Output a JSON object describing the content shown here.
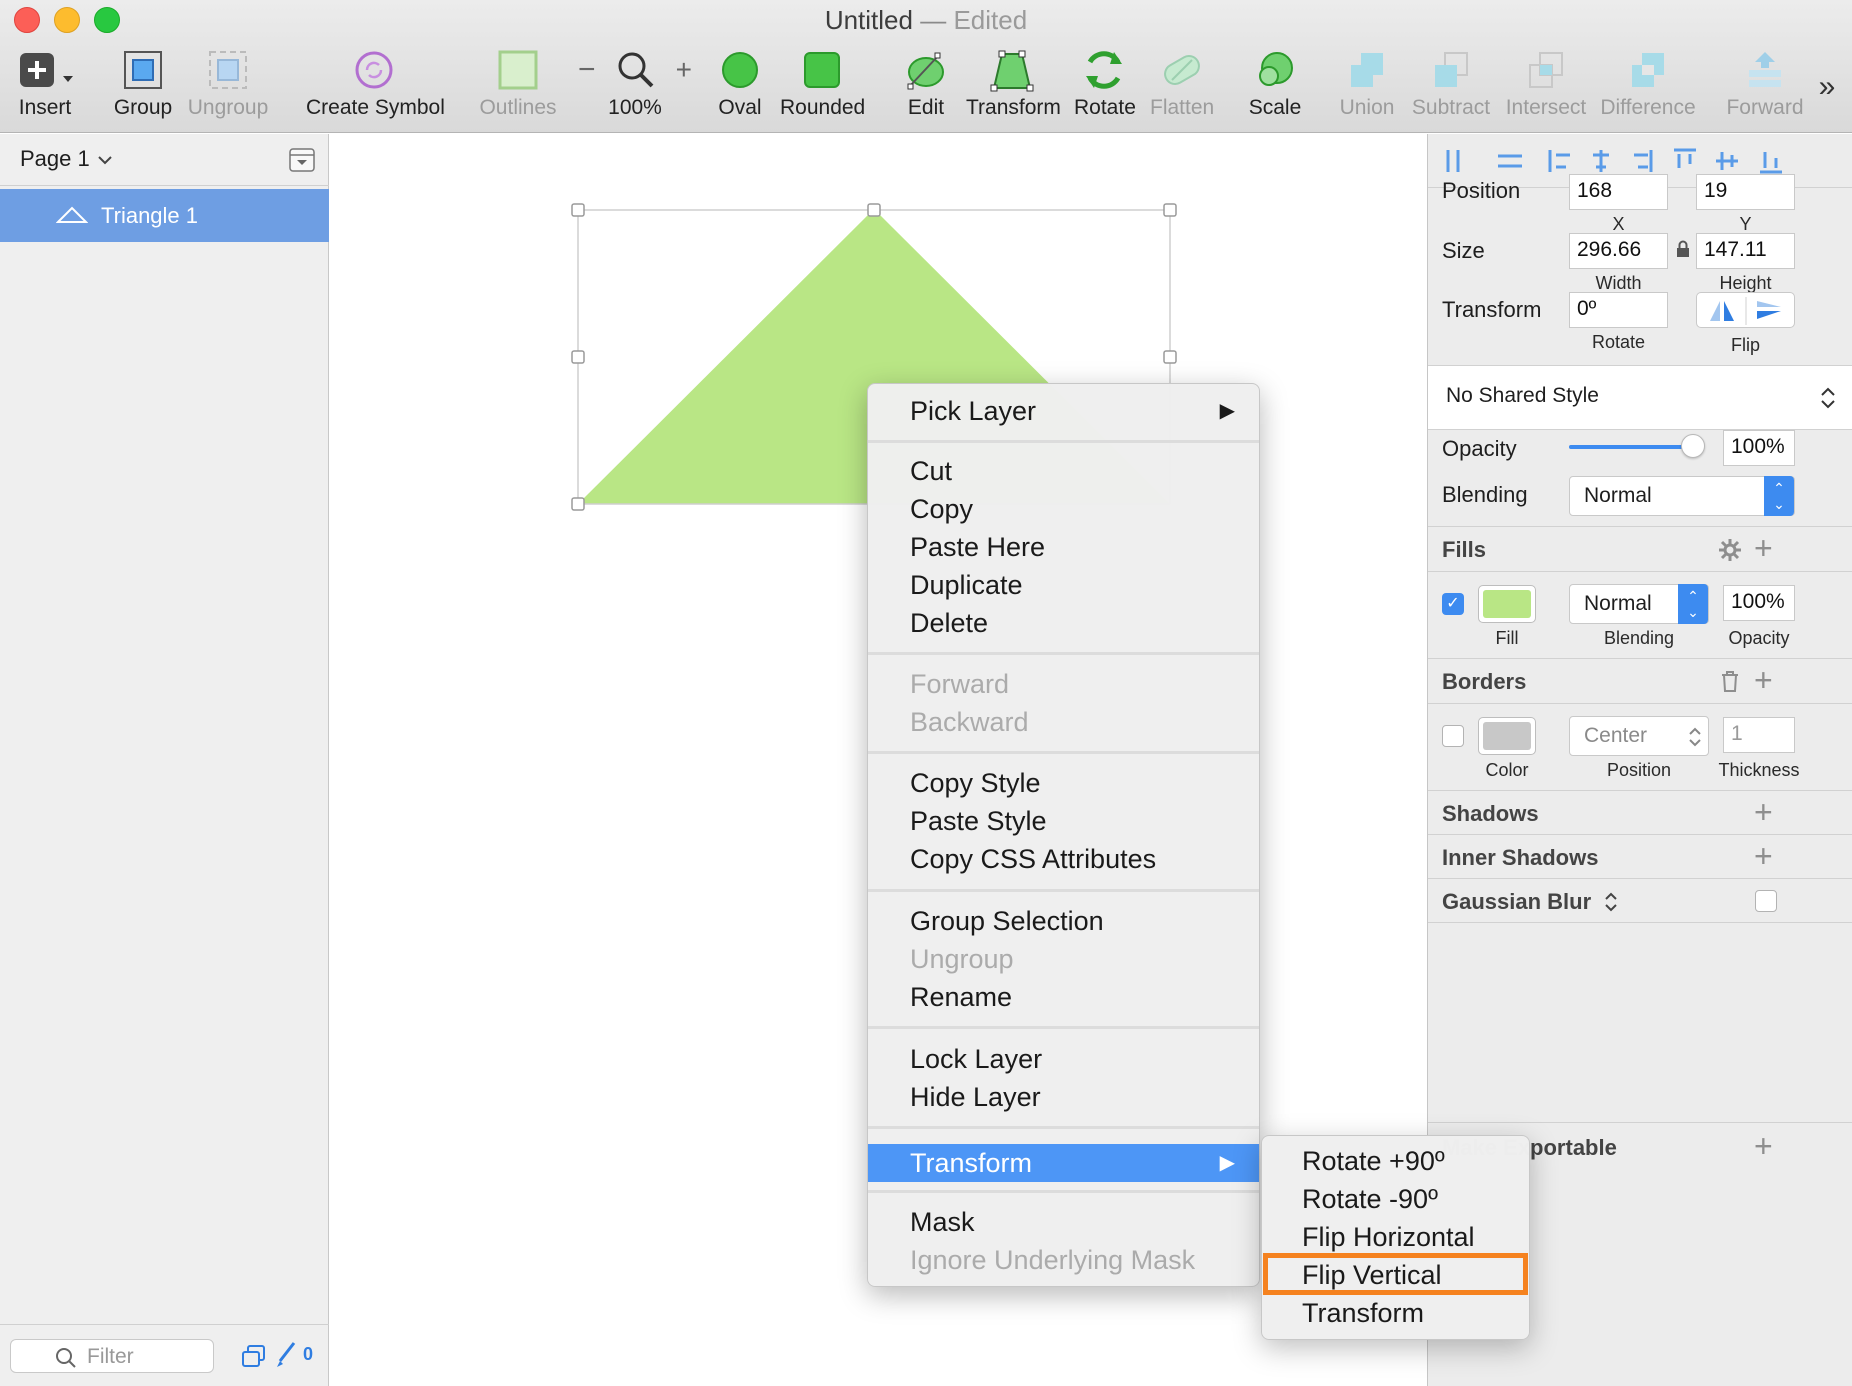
{
  "window": {
    "title": "Untitled",
    "separator": "—",
    "status": "Edited"
  },
  "toolbar": {
    "insert": "Insert",
    "group": "Group",
    "ungroup": "Ungroup",
    "create_symbol": "Create Symbol",
    "outlines": "Outlines",
    "zoom": "100%",
    "oval": "Oval",
    "rounded": "Rounded",
    "edit": "Edit",
    "transform": "Transform",
    "rotate": "Rotate",
    "flatten": "Flatten",
    "scale": "Scale",
    "union": "Union",
    "subtract": "Subtract",
    "intersect": "Intersect",
    "difference": "Difference",
    "forward": "Forward",
    "overflow": "»"
  },
  "sidebar": {
    "page": "Page 1",
    "layers": [
      {
        "name": "Triangle 1",
        "icon": "triangle-icon"
      }
    ],
    "filter_placeholder": "Filter",
    "count": "0"
  },
  "canvas": {
    "shape_color": "#b9e685",
    "shape": "triangle"
  },
  "context_menu": {
    "pick_layer": "Pick Layer",
    "cut": "Cut",
    "copy": "Copy",
    "paste_here": "Paste Here",
    "duplicate": "Duplicate",
    "delete": "Delete",
    "forward": "Forward",
    "backward": "Backward",
    "copy_style": "Copy Style",
    "paste_style": "Paste Style",
    "copy_css": "Copy CSS Attributes",
    "group_selection": "Group Selection",
    "ungroup": "Ungroup",
    "rename": "Rename",
    "lock_layer": "Lock Layer",
    "hide_layer": "Hide Layer",
    "transform": "Transform",
    "mask": "Mask",
    "ignore_mask": "Ignore Underlying Mask"
  },
  "transform_submenu": {
    "rotate_plus": "Rotate +90º",
    "rotate_minus": "Rotate -90º",
    "flip_h": "Flip Horizontal",
    "flip_v": "Flip Vertical",
    "transform": "Transform",
    "highlight_color": "#f5821f"
  },
  "inspector": {
    "position_label": "Position",
    "x": "168",
    "x_label": "X",
    "y": "19",
    "y_label": "Y",
    "size_label": "Size",
    "width": "296.66",
    "width_label": "Width",
    "height": "147.11",
    "height_label": "Height",
    "transform_label": "Transform",
    "rotate": "0º",
    "rotate_label": "Rotate",
    "flip_label": "Flip",
    "shared_style": "No Shared Style",
    "opacity_label": "Opacity",
    "opacity_value": "100%",
    "opacity_level": 1.0,
    "blending_label": "Blending",
    "blending_value": "Normal",
    "fills": {
      "header": "Fills",
      "blending": "Normal",
      "opacity": "100%",
      "fill_label": "Fill",
      "blending_label": "Blending",
      "opacity_label": "Opacity",
      "color": "#b9e685",
      "enabled": true
    },
    "borders": {
      "header": "Borders",
      "position": "Center",
      "thickness": "1",
      "color_label": "Color",
      "position_label": "Position",
      "thickness_label": "Thickness",
      "color": "#c8c8c8",
      "enabled": false
    },
    "shadows": "Shadows",
    "inner_shadows": "Inner Shadows",
    "gaussian_blur": "Gaussian Blur",
    "make_exportable": "Make Exportable",
    "accent": "#3d8bf0"
  }
}
